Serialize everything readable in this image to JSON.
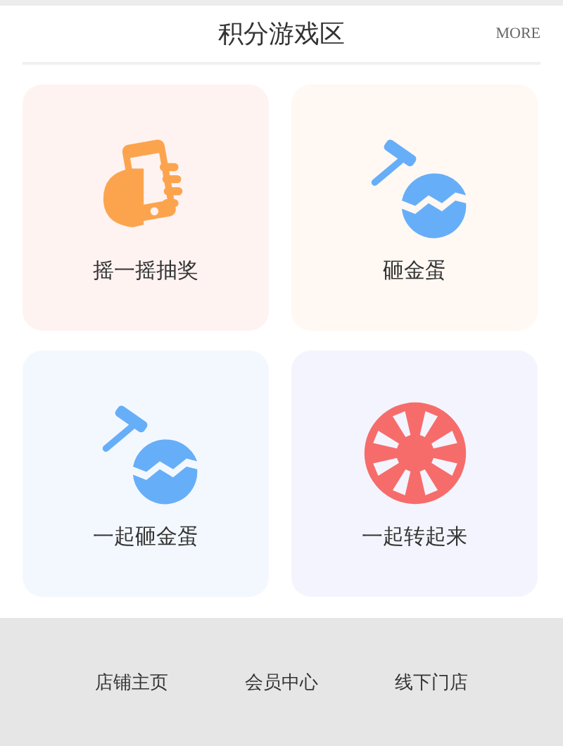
{
  "header": {
    "title": "积分游戏区",
    "more": "MORE"
  },
  "games": [
    {
      "label": "摇一摇抽奖",
      "kind": "phone",
      "color": "#fff3f2"
    },
    {
      "label": "砸金蛋",
      "kind": "hammer",
      "color": "#fff8f3"
    },
    {
      "label": "一起砸金蛋",
      "kind": "hammer",
      "color": "#f3f8ff"
    },
    {
      "label": "一起转起来",
      "kind": "wheel",
      "color": "#f4f4fe"
    }
  ],
  "footer": [
    "店铺主页",
    "会员中心",
    "线下门店"
  ]
}
